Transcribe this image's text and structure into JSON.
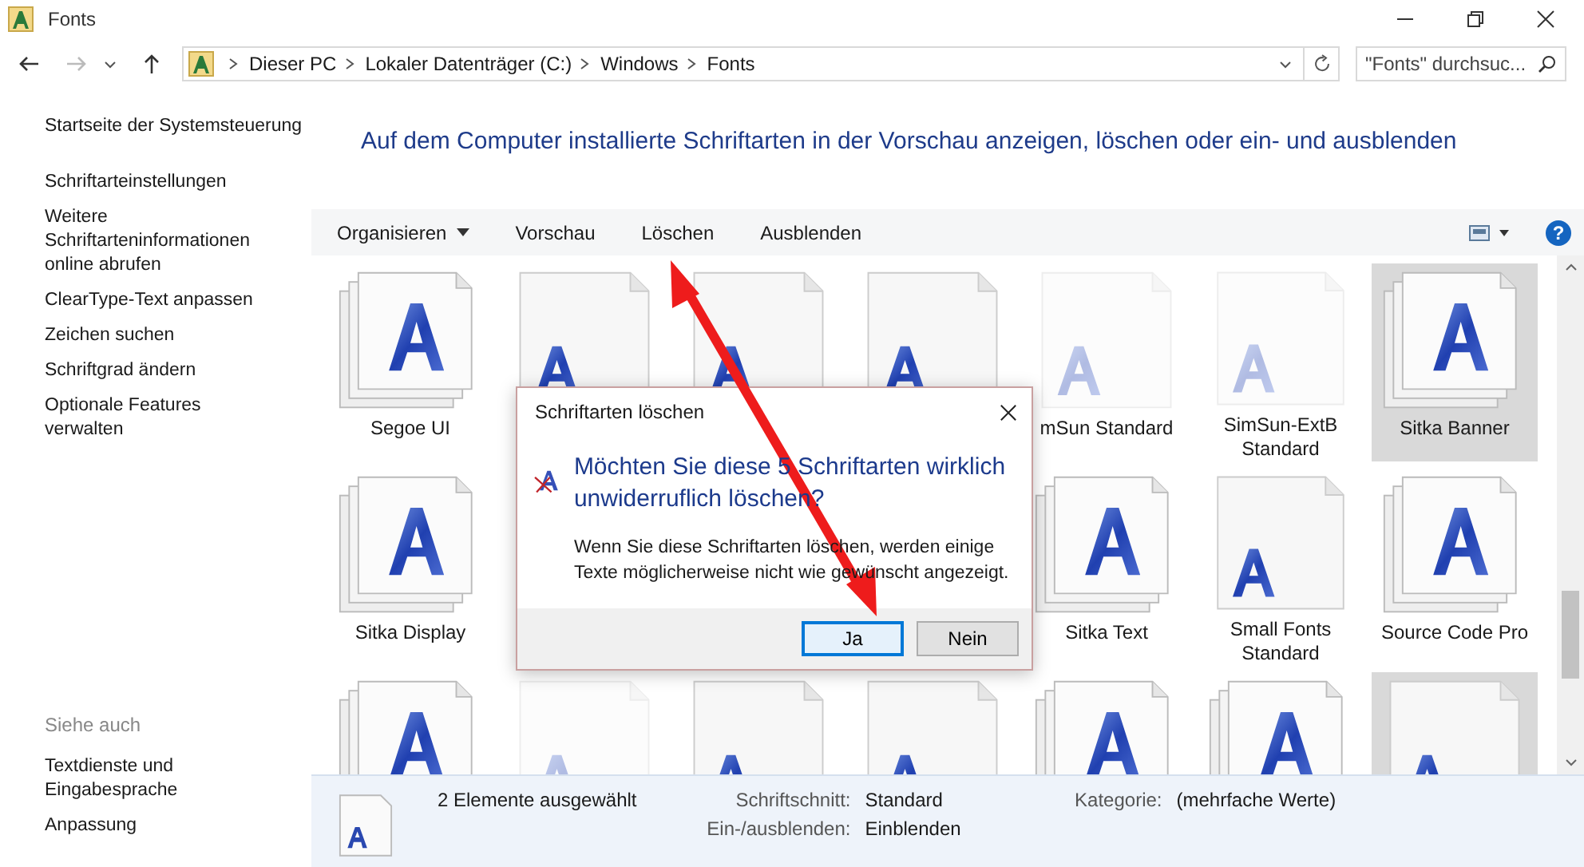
{
  "window": {
    "title": "Fonts"
  },
  "address_bar": {
    "path": [
      "Dieser PC",
      "Lokaler Datenträger (C:)",
      "Windows",
      "Fonts"
    ],
    "search": {
      "placeholder": "\"Fonts\" durchsuc..."
    }
  },
  "sidebar": {
    "items": [
      "Startseite der Systemsteuerung",
      "Schriftarteinstellungen",
      "Weitere Schriftarteninformationen online abrufen",
      "ClearType-Text anpassen",
      "Zeichen suchen",
      "Schriftgrad ändern",
      "Optionale Features verwalten"
    ],
    "see_also": {
      "heading": "Siehe auch",
      "items": [
        "Textdienste und Eingabesprache",
        "Anpassung"
      ]
    }
  },
  "heading": "Auf dem Computer installierte Schriftarten in der Vorschau anzeigen, löschen oder ein- und ausblenden",
  "toolbar": {
    "items": [
      {
        "label": "Organisieren",
        "dropdown": true
      },
      {
        "label": "Vorschau",
        "dropdown": false
      },
      {
        "label": "Löschen",
        "dropdown": false
      },
      {
        "label": "Ausblenden",
        "dropdown": false
      }
    ],
    "help": "?"
  },
  "fonts": [
    {
      "name": "Segoe UI",
      "kind": "stack",
      "faded": false,
      "selected": false
    },
    {
      "kind": "single",
      "faded": false,
      "selected": false
    },
    {
      "kind": "single",
      "faded": false,
      "selected": false
    },
    {
      "kind": "single",
      "faded": false,
      "selected": false
    },
    {
      "name": "mSun Standard",
      "kind": "single",
      "faded": true,
      "selected": false
    },
    {
      "name": "SimSun-ExtB Standard",
      "kind": "single",
      "faded": true,
      "selected": false
    },
    {
      "name": "Sitka Banner",
      "kind": "stack",
      "faded": false,
      "selected": true
    },
    {
      "name": "Sitka Display",
      "kind": "stack",
      "faded": false,
      "selected": false
    },
    {
      "kind": "covered"
    },
    {
      "kind": "covered"
    },
    {
      "kind": "covered"
    },
    {
      "name": "Sitka Text",
      "kind": "stack",
      "faded": false,
      "selected": false
    },
    {
      "name": "Small Fonts Standard",
      "kind": "single",
      "faded": false,
      "selected": false
    },
    {
      "name": "Source Code Pro",
      "kind": "stack",
      "faded": false,
      "selected": false
    },
    {
      "kind": "stack",
      "faded": false,
      "selected": false
    },
    {
      "kind": "single",
      "faded": true,
      "selected": false
    },
    {
      "kind": "single",
      "faded": false,
      "selected": false
    },
    {
      "kind": "single",
      "faded": false,
      "selected": false
    },
    {
      "kind": "stack",
      "faded": false,
      "selected": false
    },
    {
      "kind": "stack",
      "faded": false,
      "selected": false
    },
    {
      "kind": "single",
      "faded": false,
      "selected": true
    }
  ],
  "details": {
    "summary": "2 Elemente ausgewählt",
    "fields": [
      {
        "label": "Schriftschnitt:",
        "value": "Standard"
      },
      {
        "label": "Ein-/ausblenden:",
        "value": "Einblenden"
      },
      {
        "label": "Kategorie:",
        "value": "(mehrfache Werte)"
      }
    ]
  },
  "dialog": {
    "title": "Schriftarten löschen",
    "instruction": "Möchten Sie diese 5 Schriftarten wirklich unwiderruflich löschen?",
    "text": "Wenn Sie diese Schriftarten löschen, werden einige Texte möglicherweise nicht wie gewünscht angezeigt.",
    "buttons": [
      {
        "label": "Ja",
        "selected": true
      },
      {
        "label": "Nein",
        "selected": false
      }
    ]
  }
}
